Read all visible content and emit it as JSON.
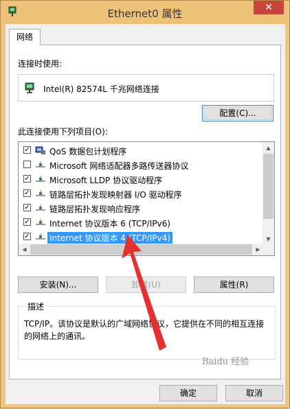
{
  "window": {
    "title": "Ethernet0 属性",
    "close_glyph": "✕"
  },
  "tabs": [
    {
      "label": "网络"
    }
  ],
  "connect_using": {
    "label": "连接时使用:",
    "adapter": "Intel(R) 82574L 千兆网络连接",
    "configure_button": "配置(C)..."
  },
  "items": {
    "label": "此连接使用下列项目(O):",
    "list": [
      {
        "label": "QoS 数据包计划程序",
        "checked": true,
        "icon": "qos-scheduler-icon"
      },
      {
        "label": "Microsoft 网络适配器多路传送器协议",
        "checked": false,
        "icon": "protocol-icon"
      },
      {
        "label": "Microsoft LLDP 协议驱动程序",
        "checked": true,
        "icon": "protocol-icon"
      },
      {
        "label": "链路层拓扑发现映射器 I/O 驱动程序",
        "checked": true,
        "icon": "protocol-icon"
      },
      {
        "label": "链路层拓扑发现响应程序",
        "checked": true,
        "icon": "protocol-icon"
      },
      {
        "label": "Internet 协议版本 6 (TCP/IPv6)",
        "checked": true,
        "icon": "protocol-icon"
      },
      {
        "label": "Internet 协议版本 4 (TCP/IPv4)",
        "checked": true,
        "icon": "protocol-icon",
        "selected": true
      }
    ]
  },
  "buttons": {
    "install": "安装(N)...",
    "uninstall": "卸载(U)",
    "properties": "属性(R)"
  },
  "description": {
    "title": "描述",
    "text": "TCP/IP。该协议是默认的广域网络协议，它提供在不同的相互连接的网络上的通讯。"
  },
  "footer": {
    "ok": "确定",
    "cancel": "取消"
  },
  "watermark": "Baidu 经验",
  "colors": {
    "selection": "#3399ff",
    "annotation_arrow": "#e53030",
    "title_bar": "#efc27a"
  }
}
